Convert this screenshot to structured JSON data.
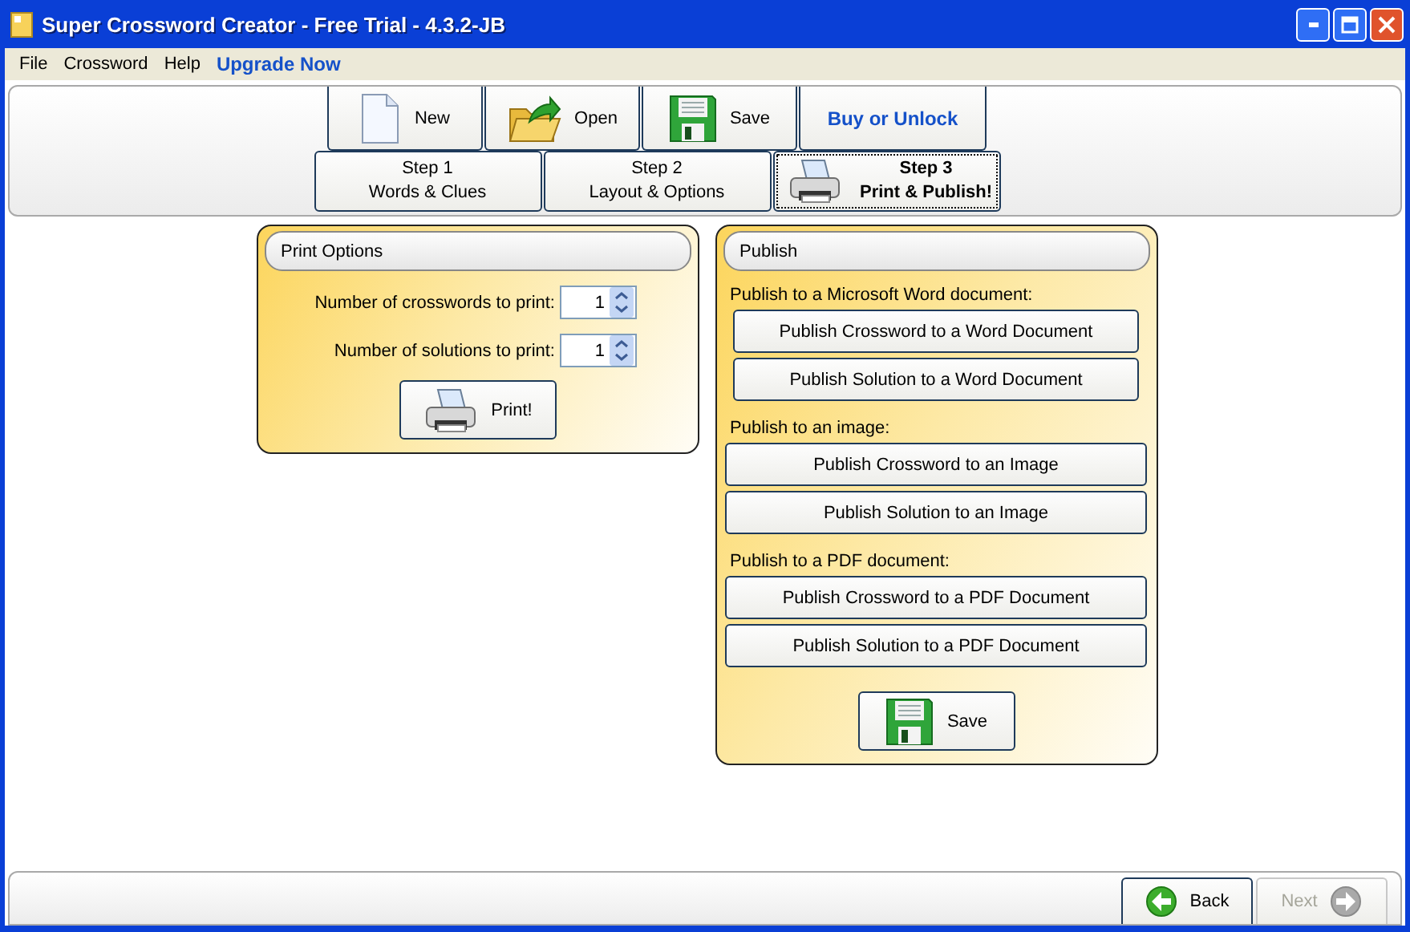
{
  "window": {
    "title": "Super Crossword Creator - Free Trial - 4.3.2-JB"
  },
  "menu": [
    {
      "label": "File",
      "kind": "menu"
    },
    {
      "label": "Crossword",
      "kind": "menu"
    },
    {
      "label": "Help",
      "kind": "menu"
    },
    {
      "label": "Upgrade Now",
      "kind": "promo"
    }
  ],
  "toolbar": [
    {
      "label": "New",
      "kind": "new"
    },
    {
      "label": "Open",
      "kind": "open"
    },
    {
      "label": "Save",
      "kind": "save"
    },
    {
      "label": "Buy or Unlock",
      "kind": "purchase"
    }
  ],
  "steps": [
    {
      "step": "Step 1",
      "label": "Words & Clues",
      "selected": false
    },
    {
      "step": "Step 2",
      "label": "Layout & Options",
      "selected": false
    },
    {
      "step": "Step 3",
      "label": "Print & Publish!",
      "selected": true
    }
  ],
  "print_options": {
    "title": "Print Options",
    "fields": [
      {
        "label": "Number of crosswords to print:",
        "value": "1"
      },
      {
        "label": "Number of solutions to print:",
        "value": "1"
      }
    ],
    "button": "Print!"
  },
  "publish": {
    "title": "Publish",
    "groups": [
      {
        "heading": "Publish to a Microsoft Word document:",
        "buttons": [
          "Publish Crossword to a Word Document",
          "Publish Solution to a Word Document"
        ]
      },
      {
        "heading": "Publish to an image:",
        "buttons": [
          "Publish Crossword to an Image",
          "Publish Solution to an Image"
        ]
      },
      {
        "heading": "Publish to a PDF document:",
        "buttons": [
          "Publish Crossword to a PDF Document",
          "Publish Solution to a PDF Document"
        ]
      }
    ],
    "button": "Save"
  },
  "navigation": [
    {
      "label": "Back",
      "kind": "back",
      "disabled": false
    },
    {
      "label": "Next",
      "kind": "next",
      "disabled": true
    }
  ]
}
